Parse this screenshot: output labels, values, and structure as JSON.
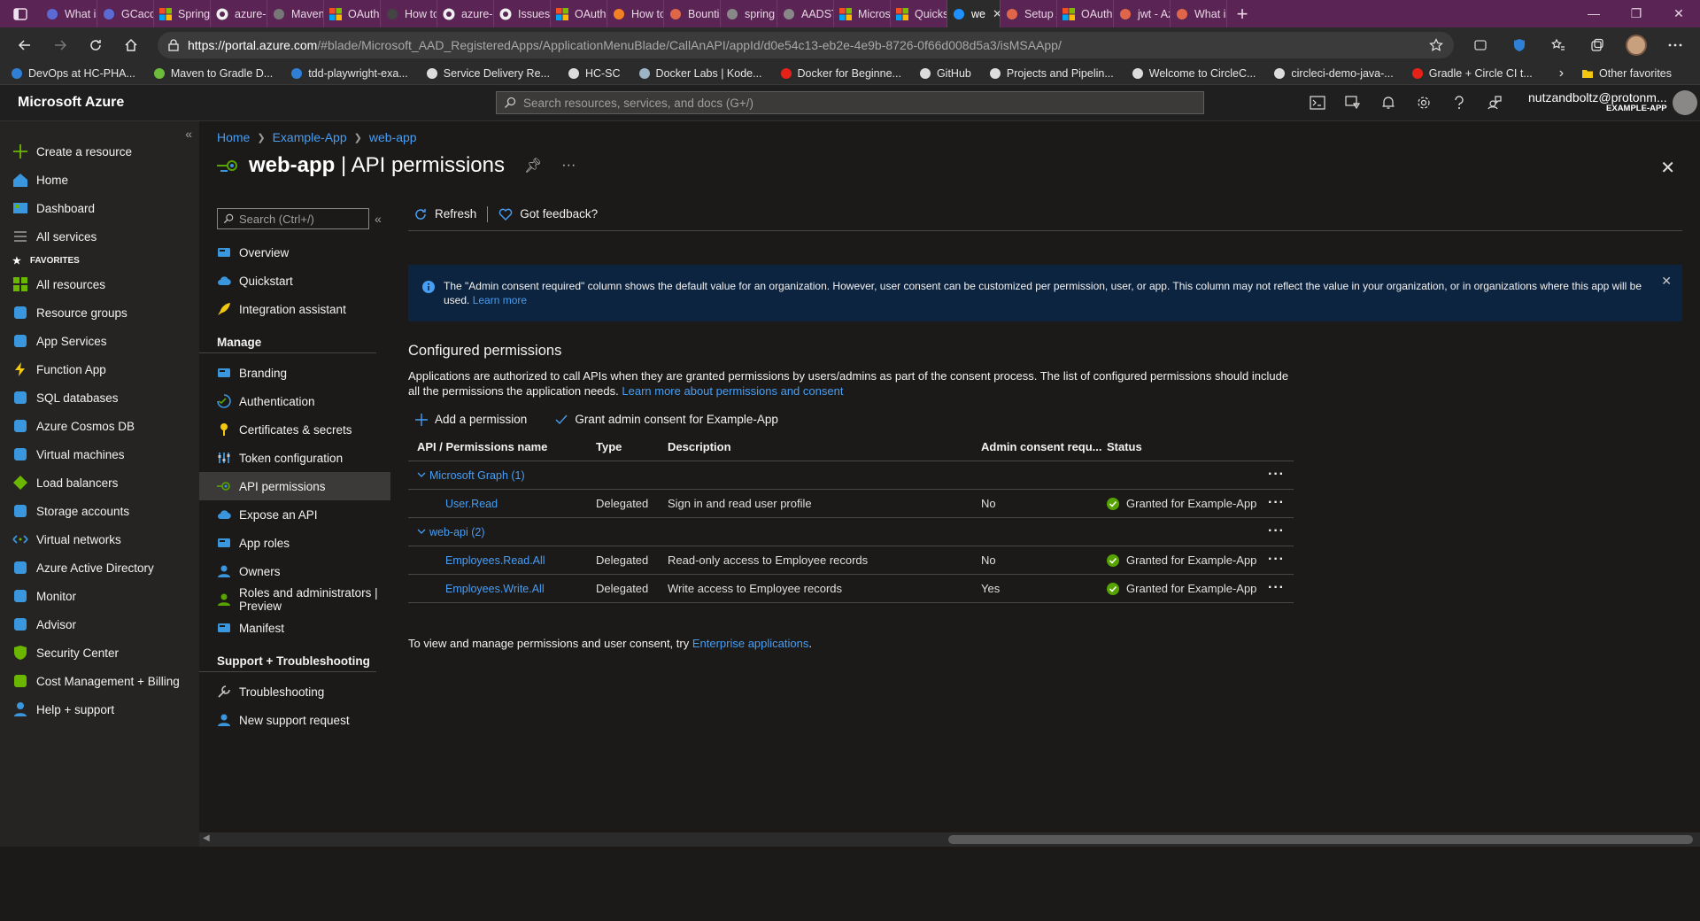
{
  "browser": {
    "tabs": [
      {
        "label": "What is",
        "fav": "#5b6bd5"
      },
      {
        "label": "GCacco",
        "fav": "#5b6bd5"
      },
      {
        "label": "Spring",
        "fav": "ms"
      },
      {
        "label": "azure-s",
        "fav": "gh"
      },
      {
        "label": "Maven",
        "fav": "#777"
      },
      {
        "label": "OAuth",
        "fav": "ms"
      },
      {
        "label": "How to",
        "fav": "#444"
      },
      {
        "label": "azure-s",
        "fav": "gh"
      },
      {
        "label": "Issues",
        "fav": "gh"
      },
      {
        "label": "OAuth",
        "fav": "ms"
      },
      {
        "label": "How to",
        "fav": "#f48024"
      },
      {
        "label": "Bountie",
        "fav": "#e0664a"
      },
      {
        "label": "spring",
        "fav": "#888"
      },
      {
        "label": "AADST",
        "fav": "#888"
      },
      {
        "label": "Micros",
        "fav": "ms"
      },
      {
        "label": "Quickst",
        "fav": "ms"
      },
      {
        "label": "we",
        "fav": "#1e90ff",
        "active": true
      },
      {
        "label": "Setup A",
        "fav": "#e0664a"
      },
      {
        "label": "OAuth",
        "fav": "ms"
      },
      {
        "label": "jwt - Az",
        "fav": "#e0664a"
      },
      {
        "label": "What is",
        "fav": "#e0664a"
      }
    ],
    "url_host": "https://portal.azure.com",
    "url_path": "/#blade/Microsoft_AAD_RegisteredApps/ApplicationMenuBlade/CallAnAPI/appId/d0e54c13-eb2e-4e9b-8726-0f66d008d5a3/isMSAApp/",
    "bookmarks": [
      {
        "label": "DevOps at HC-PHA...",
        "color": "#2f7fd6"
      },
      {
        "label": "Maven to Gradle D...",
        "color": "#6cbb3c"
      },
      {
        "label": "tdd-playwright-exa...",
        "color": "#2f7fd6"
      },
      {
        "label": "Service Delivery Re...",
        "color": "#ddd"
      },
      {
        "label": "HC-SC",
        "color": "#ddd"
      },
      {
        "label": "Docker Labs | Kode...",
        "color": "#9db3c6"
      },
      {
        "label": "Docker for Beginne...",
        "color": "#e62117"
      },
      {
        "label": "GitHub",
        "color": "#ddd"
      },
      {
        "label": "Projects and Pipelin...",
        "color": "#ddd"
      },
      {
        "label": "Welcome to CircleC...",
        "color": "#ddd"
      },
      {
        "label": "circleci-demo-java-...",
        "color": "#ddd"
      },
      {
        "label": "Gradle + Circle CI t...",
        "color": "#e62117"
      }
    ],
    "other_favorites": "Other favorites"
  },
  "portal": {
    "brand": "Microsoft Azure",
    "search_placeholder": "Search resources, services, and docs (G+/)",
    "user_email": "nutzandboltz@protonm...",
    "user_tenant": "EXAMPLE-APP"
  },
  "leftnav": {
    "items": [
      {
        "label": "Create a resource",
        "icon": "plus-icon",
        "color": "#6bb700"
      },
      {
        "label": "Home",
        "icon": "home-icon",
        "color": "#3a96dd"
      },
      {
        "label": "Dashboard",
        "icon": "dashboard-icon",
        "color": "#3a96dd"
      },
      {
        "label": "All services",
        "icon": "list-icon",
        "color": "#a19f9d"
      }
    ],
    "favorites_label": "FAVORITES",
    "favorites": [
      {
        "label": "All resources",
        "icon": "grid-icon",
        "color": "#6bb700"
      },
      {
        "label": "Resource groups",
        "icon": "cube-icon",
        "color": "#3a96dd"
      },
      {
        "label": "App Services",
        "icon": "globe-icon",
        "color": "#3a96dd"
      },
      {
        "label": "Function App",
        "icon": "bolt-icon",
        "color": "#f2c811"
      },
      {
        "label": "SQL databases",
        "icon": "database-icon",
        "color": "#3a96dd"
      },
      {
        "label": "Azure Cosmos DB",
        "icon": "planet-icon",
        "color": "#3a96dd"
      },
      {
        "label": "Virtual machines",
        "icon": "monitor-icon",
        "color": "#3a96dd"
      },
      {
        "label": "Load balancers",
        "icon": "diamond-icon",
        "color": "#6bb700"
      },
      {
        "label": "Storage accounts",
        "icon": "storage-icon",
        "color": "#3a96dd"
      },
      {
        "label": "Virtual networks",
        "icon": "network-icon",
        "color": "#3a96dd"
      },
      {
        "label": "Azure Active Directory",
        "icon": "aad-icon",
        "color": "#3a96dd"
      },
      {
        "label": "Monitor",
        "icon": "gauge-icon",
        "color": "#3a96dd"
      },
      {
        "label": "Advisor",
        "icon": "cloud-icon",
        "color": "#3a96dd"
      },
      {
        "label": "Security Center",
        "icon": "shield-icon",
        "color": "#6bb700"
      },
      {
        "label": "Cost Management + Billing",
        "icon": "coin-icon",
        "color": "#6bb700"
      },
      {
        "label": "Help + support",
        "icon": "person-icon",
        "color": "#3a96dd"
      }
    ]
  },
  "breadcrumb": [
    "Home",
    "Example-App",
    "web-app"
  ],
  "title": {
    "app": "web-app",
    "rest": " | API permissions"
  },
  "menu": {
    "search_placeholder": "Search (Ctrl+/)",
    "top": [
      {
        "label": "Overview",
        "icon": "overview-icon"
      },
      {
        "label": "Quickstart",
        "icon": "cloud-quickstart-icon"
      },
      {
        "label": "Integration assistant",
        "icon": "rocket-icon"
      }
    ],
    "manage_label": "Manage",
    "manage": [
      {
        "label": "Branding",
        "icon": "branding-icon"
      },
      {
        "label": "Authentication",
        "icon": "authentication-icon"
      },
      {
        "label": "Certificates & secrets",
        "icon": "key-icon"
      },
      {
        "label": "Token configuration",
        "icon": "token-icon"
      },
      {
        "label": "API permissions",
        "icon": "api-permissions-icon",
        "selected": true
      },
      {
        "label": "Expose an API",
        "icon": "cloud-api-icon"
      },
      {
        "label": "App roles",
        "icon": "app-roles-icon"
      },
      {
        "label": "Owners",
        "icon": "owners-icon"
      },
      {
        "label": "Roles and administrators | Preview",
        "icon": "admin-icon"
      },
      {
        "label": "Manifest",
        "icon": "manifest-icon"
      }
    ],
    "support_label": "Support + Troubleshooting",
    "support": [
      {
        "label": "Troubleshooting",
        "icon": "wrench-icon"
      },
      {
        "label": "New support request",
        "icon": "support-person-icon"
      }
    ]
  },
  "toolbar": {
    "refresh": "Refresh",
    "feedback": "Got feedback?"
  },
  "info": {
    "text": "The \"Admin consent required\" column shows the default value for an organization. However, user consent can be customized per permission, user, or app. This column may not reflect the value in your organization, or in organizations where this app will be used.",
    "link": "Learn more"
  },
  "configured": {
    "title": "Configured permissions",
    "desc": "Applications are authorized to call APIs when they are granted permissions by users/admins as part of the consent process. The list of configured permissions should include all the permissions the application needs.",
    "desc_link": "Learn more about permissions and consent",
    "add": "Add a permission",
    "grant": "Grant admin consent for Example-App"
  },
  "table": {
    "headers": [
      "API / Permissions name",
      "Type",
      "Description",
      "Admin consent requ...",
      "Status"
    ],
    "groups": [
      {
        "name": "Microsoft Graph (1)",
        "rows": [
          {
            "name": "User.Read",
            "type": "Delegated",
            "desc": "Sign in and read user profile",
            "admin": "No",
            "status": "Granted for Example-App"
          }
        ]
      },
      {
        "name": "web-api (2)",
        "rows": [
          {
            "name": "Employees.Read.All",
            "type": "Delegated",
            "desc": "Read-only access to Employee records",
            "admin": "No",
            "status": "Granted for Example-App"
          },
          {
            "name": "Employees.Write.All",
            "type": "Delegated",
            "desc": "Write access to Employee records",
            "admin": "Yes",
            "status": "Granted for Example-App"
          }
        ]
      }
    ]
  },
  "footer": {
    "text": "To view and manage permissions and user consent, try ",
    "link": "Enterprise applications",
    "end": "."
  },
  "colors": {
    "accent": "#479ef5",
    "granted": "#57a300",
    "selected_bg": "#3b3a39",
    "info_bg": "#0c2440",
    "tab_strip": "#5a2554"
  }
}
